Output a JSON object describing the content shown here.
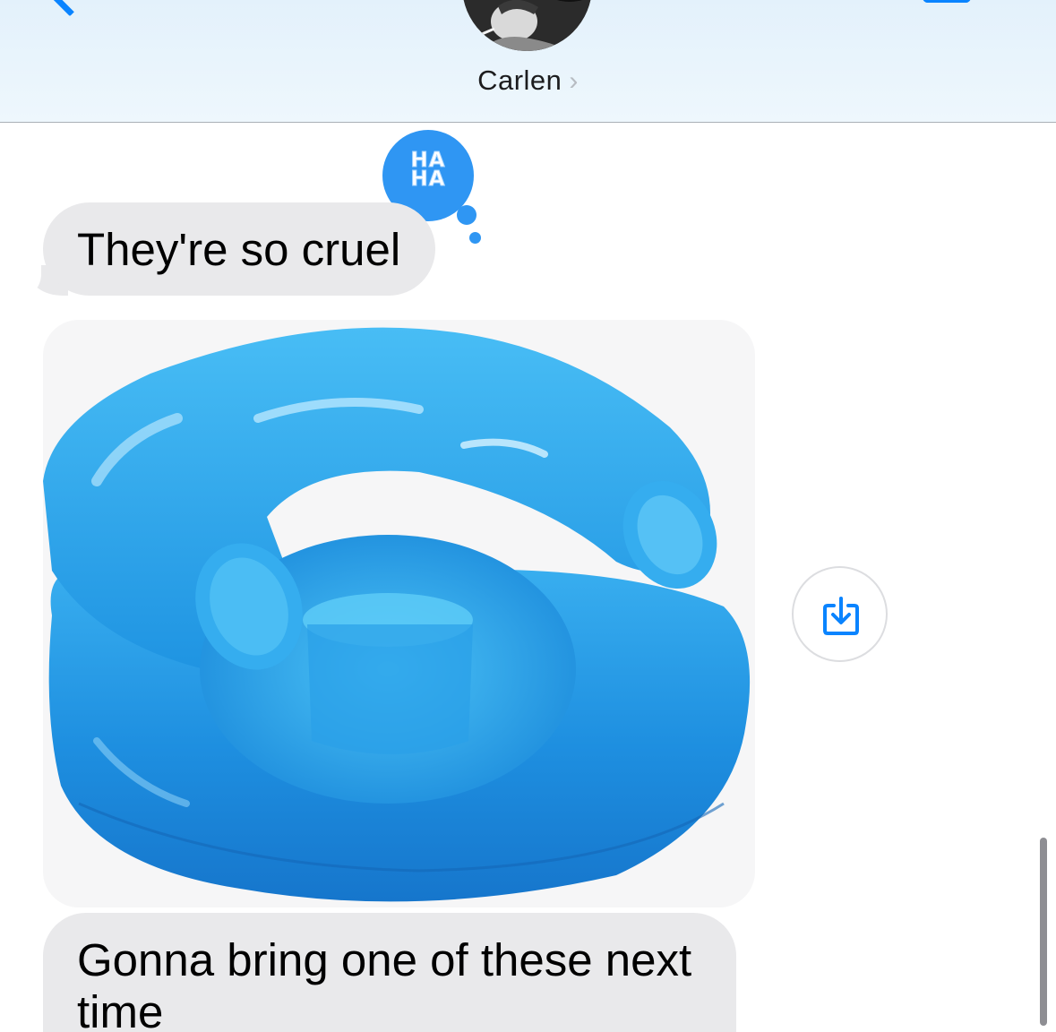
{
  "header": {
    "contact_name": "Carlen",
    "contact_chevron": "›",
    "back_icon": "chevron-left-icon",
    "video_icon": "video-camera-icon",
    "avatar": "contact-avatar-photo"
  },
  "conversation": {
    "tapback": {
      "label_line1": "HA",
      "label_line2": "HA",
      "color": "#2f96f3"
    },
    "messages": [
      {
        "type": "text",
        "direction": "incoming",
        "text": "They're so cruel"
      },
      {
        "type": "image",
        "direction": "incoming",
        "description_icon": "inflatable-chair-image"
      },
      {
        "type": "text",
        "direction": "incoming",
        "text": "Gonna bring one of these next time"
      }
    ],
    "save_button_icon": "save-download-icon"
  },
  "colors": {
    "accent": "#0a84ff",
    "incoming_bubble": "#e9e9eb",
    "header_bg": "#e3f1fb"
  }
}
